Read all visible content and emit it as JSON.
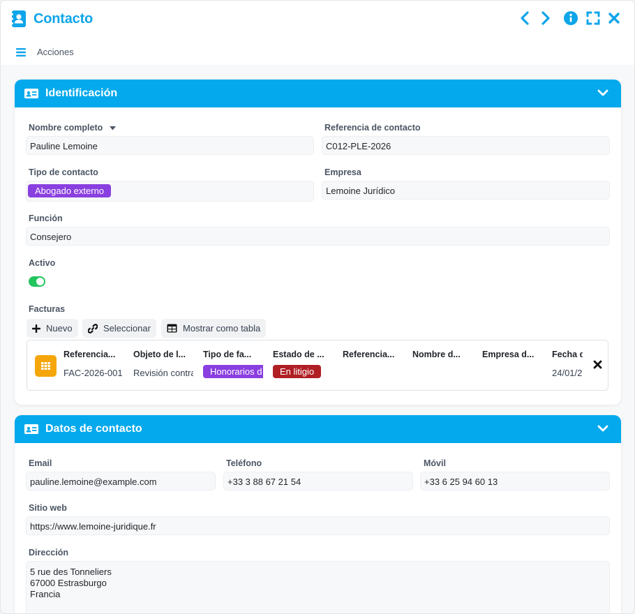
{
  "window": {
    "title": "Contacto"
  },
  "toolbar": {
    "actions_label": "Acciones"
  },
  "identificacion": {
    "title": "Identificación",
    "nombre_label": "Nombre completo",
    "nombre_value": "Pauline Lemoine",
    "referencia_label": "Referencia de contacto",
    "referencia_value": "C012-PLE-2026",
    "tipo_label": "Tipo de contacto",
    "tipo_value": "Abogado externo",
    "empresa_label": "Empresa",
    "empresa_value": "Lemoine Jurídico",
    "funcion_label": "Función",
    "funcion_value": "Consejero",
    "activo_label": "Activo",
    "activo_on": true,
    "facturas_label": "Facturas",
    "buttons": {
      "nuevo": "Nuevo",
      "seleccionar": "Seleccionar",
      "tabla": "Mostrar como tabla"
    },
    "invoice": {
      "columns": [
        "Referencia...",
        "Objeto de l...",
        "Tipo de fa...",
        "Estado de ...",
        "Referencia...",
        "Nombre d...",
        "Empresa d...",
        "Fecha d"
      ],
      "row": {
        "referencia": "FAC-2026-001",
        "objeto": "Revisión contrato",
        "tipo": "Honorarios d",
        "estado": "En litigio",
        "fecha": "24/01/2"
      }
    }
  },
  "datos": {
    "title": "Datos de contacto",
    "email_label": "Email",
    "email_value": "pauline.lemoine@example.com",
    "telefono_label": "Teléfono",
    "telefono_value": "+33 3 88 67 21 54",
    "movil_label": "Móvil",
    "movil_value": "+33 6 25 94 60 13",
    "web_label": "Sitio web",
    "web_value": "https://www.lemoine-juridique.fr",
    "direccion_label": "Dirección",
    "direccion_lines": [
      "5 rue des Tonneliers",
      "67000 Estrasburgo",
      "Francia"
    ]
  },
  "colors": {
    "accent": "#03a9ec",
    "tag_purple": "#8a3fe0",
    "badge_red": "#b01f24",
    "toggle_green": "#22c55e",
    "invoice_icon": "#f5a60b"
  },
  "icons": {
    "title": "contact-book-icon",
    "prev": "chevron-left-icon",
    "next": "chevron-right-icon",
    "info": "info-icon",
    "expand": "fullscreen-icon",
    "close": "close-icon",
    "menu": "hamburger-icon",
    "section": "id-card-icon",
    "collapse": "chevron-down-icon",
    "invoice": "table-grid-icon"
  }
}
